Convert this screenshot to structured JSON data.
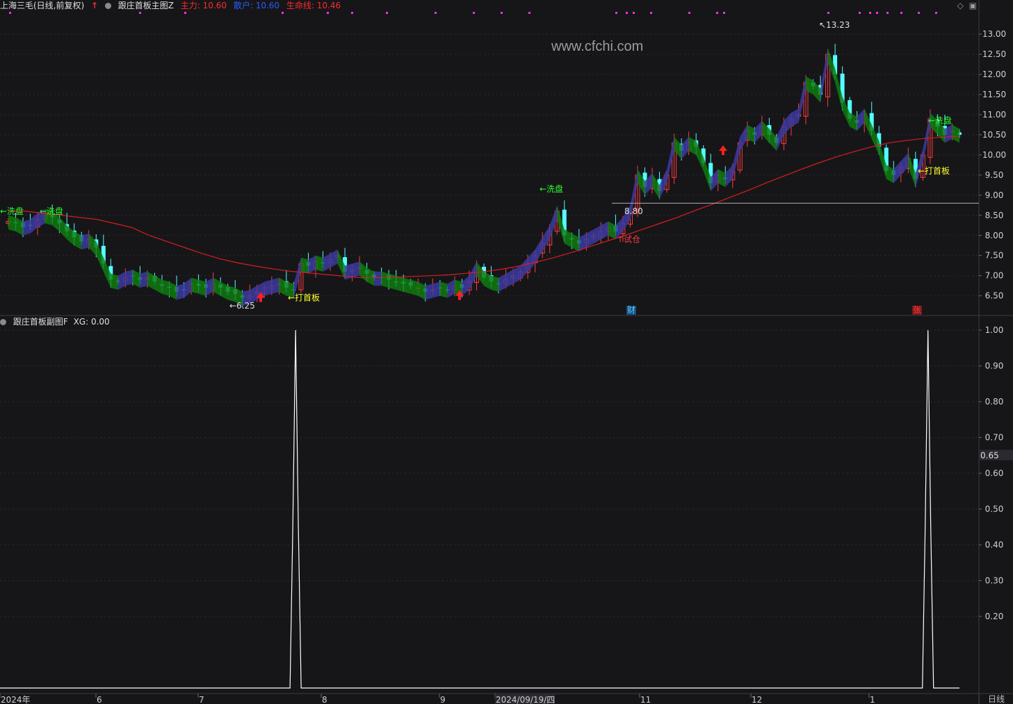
{
  "main_header": {
    "title": "上海三毛(日线,前复权)",
    "indicator_name": "跟庄首板主图Z",
    "zhuli": "主力: 10.60",
    "sanhu": "散户: 10.60",
    "shengming": "生命线: 10.46",
    "colors": {
      "zhuli": "#ff2a2a",
      "sanhu": "#2a5cff",
      "shengming": "#ff2a2a"
    }
  },
  "sub_header": {
    "indicator_name": "跟庄首板副图F",
    "xg": "XG: 0.00"
  },
  "watermark": "www.cfchi.com",
  "period": "日线",
  "icons": [
    "diamond-icon",
    "window-icon"
  ],
  "chart_data": [
    {
      "type": "candlestick",
      "panel": "main",
      "ylim": [
        6.2,
        13.4
      ],
      "y_ticks": [
        "13.00",
        "12.50",
        "12.00",
        "11.50",
        "11.00",
        "10.50",
        "10.00",
        "9.50",
        "9.00",
        "8.50",
        "8.00",
        "7.50",
        "7.00",
        "6.50"
      ],
      "x_ticks": [
        "2024年",
        "6",
        "7",
        "8",
        "9",
        "2024/09/19/四",
        "11",
        "12",
        "1"
      ],
      "ohlc_close_path": [
        8.35,
        8.3,
        8.2,
        8.25,
        8.4,
        8.5,
        8.45,
        8.3,
        8.1,
        7.95,
        7.85,
        7.9,
        7.7,
        7.3,
        6.9,
        6.85,
        6.95,
        7.0,
        6.9,
        6.95,
        6.85,
        6.75,
        6.7,
        6.6,
        6.65,
        6.8,
        6.75,
        6.7,
        6.8,
        6.7,
        6.6,
        6.55,
        6.45,
        6.5,
        6.6,
        6.7,
        6.75,
        6.8,
        6.7,
        6.65,
        7.3,
        7.25,
        7.35,
        7.3,
        7.4,
        7.5,
        7.1,
        7.15,
        7.2,
        7.05,
        6.95,
        6.95,
        6.9,
        6.85,
        6.8,
        6.75,
        6.7,
        6.6,
        6.65,
        6.7,
        6.65,
        6.75,
        6.7,
        6.85,
        7.2,
        6.95,
        6.85,
        6.8,
        6.9,
        7.0,
        7.1,
        7.3,
        7.5,
        7.8,
        8.1,
        8.6,
        8.0,
        7.9,
        7.8,
        7.9,
        8.0,
        8.1,
        8.2,
        8.1,
        8.3,
        8.6,
        9.5,
        9.2,
        9.4,
        9.1,
        9.5,
        10.3,
        10.1,
        10.3,
        10.2,
        9.8,
        9.3,
        9.5,
        9.4,
        9.6,
        10.3,
        10.6,
        10.5,
        10.7,
        10.5,
        10.3,
        10.7,
        10.9,
        11.0,
        11.8,
        11.7,
        11.5,
        12.5,
        12.0,
        11.3,
        10.9,
        10.8,
        11.0,
        10.6,
        10.2,
        9.6,
        9.5,
        9.7,
        9.9,
        9.4,
        10.0,
        10.9,
        10.7,
        10.5,
        10.6,
        10.5
      ],
      "ma_line_name": "生命线",
      "ma_values": [
        8.6,
        8.6,
        8.55,
        8.5,
        8.45,
        8.4,
        8.3,
        8.2,
        8.0,
        7.85,
        7.7,
        7.55,
        7.42,
        7.32,
        7.24,
        7.17,
        7.11,
        7.07,
        7.03,
        6.99,
        6.95,
        6.95,
        6.96,
        6.98,
        7.0,
        7.02,
        7.06,
        7.1,
        7.16,
        7.24,
        7.34,
        7.45,
        7.58,
        7.72,
        7.86,
        8.0,
        8.15,
        8.3,
        8.45,
        8.62,
        8.78,
        8.95,
        9.12,
        9.3,
        9.47,
        9.64,
        9.8,
        9.95,
        10.08,
        10.2,
        10.3,
        10.36,
        10.41,
        10.44,
        10.46
      ],
      "annotations": [
        {
          "text": "←洗盘",
          "price": 8.6
        },
        {
          "text": "←洗盘",
          "price": 8.6
        },
        {
          "text": "←6.25",
          "price": 6.25
        },
        {
          "text": "←打首板",
          "price": 6.45
        },
        {
          "text": "←洗盘",
          "price": 9.15
        },
        {
          "text": "8.80",
          "price": 8.6
        },
        {
          "text": "↑试仓",
          "price": 7.9
        },
        {
          "text": "↖13.23",
          "price": 13.23
        },
        {
          "text": "←打首板",
          "price": 9.6
        },
        {
          "text": "←洗盘",
          "price": 10.85
        },
        {
          "text": "财",
          "price": null
        },
        {
          "text": "张",
          "price": null
        }
      ],
      "level_line": {
        "price": 8.8,
        "label": "8.80"
      }
    },
    {
      "type": "line",
      "panel": "sub",
      "name": "XG",
      "ylim": [
        0,
        1.0
      ],
      "y_ticks": [
        "1.00",
        "0.90",
        "0.80",
        "0.70",
        "0.60",
        "0.50",
        "0.40",
        "0.30",
        "0.20"
      ],
      "current_marker": "0.65",
      "spikes_at_ratio": [
        0.292,
        0.938
      ],
      "peak_value": 1.0
    }
  ]
}
